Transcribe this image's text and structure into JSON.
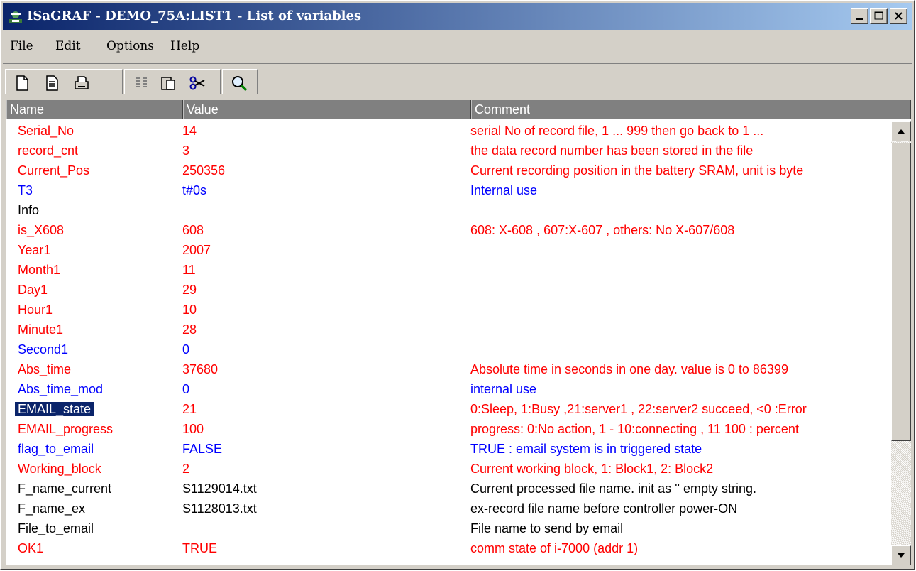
{
  "window": {
    "title": "ISaGRAF - DEMO_75A:LIST1 - List of variables",
    "controls": [
      "minimize",
      "maximize",
      "close"
    ]
  },
  "menu": [
    "File",
    "Edit",
    "Options",
    "Help"
  ],
  "toolbar": {
    "buttons": [
      "new-icon",
      "properties-icon",
      "print-icon",
      "insert-icon",
      "paste-icon",
      "cut-icon",
      "search-icon"
    ]
  },
  "columns": {
    "name": "Name",
    "value": "Value",
    "comment": "Comment"
  },
  "colors": {
    "red": "#ff0000",
    "blue": "#0000ff",
    "black": "#000000",
    "title_bar": "#0a246a",
    "selection": "#0a246a",
    "header_bg": "#808080"
  },
  "rows": [
    {
      "name": "Serial_No",
      "value": "14",
      "comment": "serial No of record file, 1 ... 999 then go back to 1 ...",
      "color": "red"
    },
    {
      "name": "record_cnt",
      "value": "3",
      "comment": "the data record number has been stored in the file",
      "color": "red"
    },
    {
      "name": "Current_Pos",
      "value": "250356",
      "comment": "Current recording position in the battery SRAM, unit is byte",
      "color": "red"
    },
    {
      "name": "T3",
      "value": "t#0s",
      "comment": "Internal use",
      "color": "blue"
    },
    {
      "name": "Info",
      "value": "",
      "comment": "",
      "color": "black"
    },
    {
      "name": "is_X608",
      "value": "608",
      "comment": "608: X-608 , 607:X-607 , others: No X-607/608",
      "color": "red"
    },
    {
      "name": "Year1",
      "value": "2007",
      "comment": "",
      "color": "red"
    },
    {
      "name": "Month1",
      "value": "11",
      "comment": "",
      "color": "red"
    },
    {
      "name": "Day1",
      "value": "29",
      "comment": "",
      "color": "red"
    },
    {
      "name": "Hour1",
      "value": "10",
      "comment": "",
      "color": "red"
    },
    {
      "name": "Minute1",
      "value": "28",
      "comment": "",
      "color": "red"
    },
    {
      "name": "Second1",
      "value": "0",
      "comment": "",
      "color": "blue"
    },
    {
      "name": "Abs_time",
      "value": "37680",
      "comment": "Absolute time in seconds in one day.  value is 0 to 86399",
      "color": "red"
    },
    {
      "name": "Abs_time_mod",
      "value": "0",
      "comment": "internal use",
      "color": "blue"
    },
    {
      "name": "EMAIL_state",
      "value": "21",
      "comment": "0:Sleep, 1:Busy ,21:server1 , 22:server2 succeed, <0 :Error",
      "color": "red",
      "selected": true
    },
    {
      "name": "EMAIL_progress",
      "value": "100",
      "comment": "progress: 0:No action, 1 - 10:connecting , 11  100 : percent",
      "color": "red"
    },
    {
      "name": "flag_to_email",
      "value": "FALSE",
      "comment": "TRUE : email system is in triggered state",
      "color": "blue"
    },
    {
      "name": "Working_block",
      "value": "2",
      "comment": "Current working block, 1: Block1, 2: Block2",
      "color": "red"
    },
    {
      "name": "F_name_current",
      "value": "S1129014.txt",
      "comment": "Current processed file name. init as '' empty string.",
      "color": "black"
    },
    {
      "name": "F_name_ex",
      "value": "S1128013.txt",
      "comment": "ex-record file name before controller power-ON",
      "color": "black"
    },
    {
      "name": "File_to_email",
      "value": "",
      "comment": "File name to send by email",
      "color": "black"
    },
    {
      "name": "OK1",
      "value": "TRUE",
      "comment": "comm state of i-7000 (addr 1)",
      "color": "red"
    }
  ]
}
